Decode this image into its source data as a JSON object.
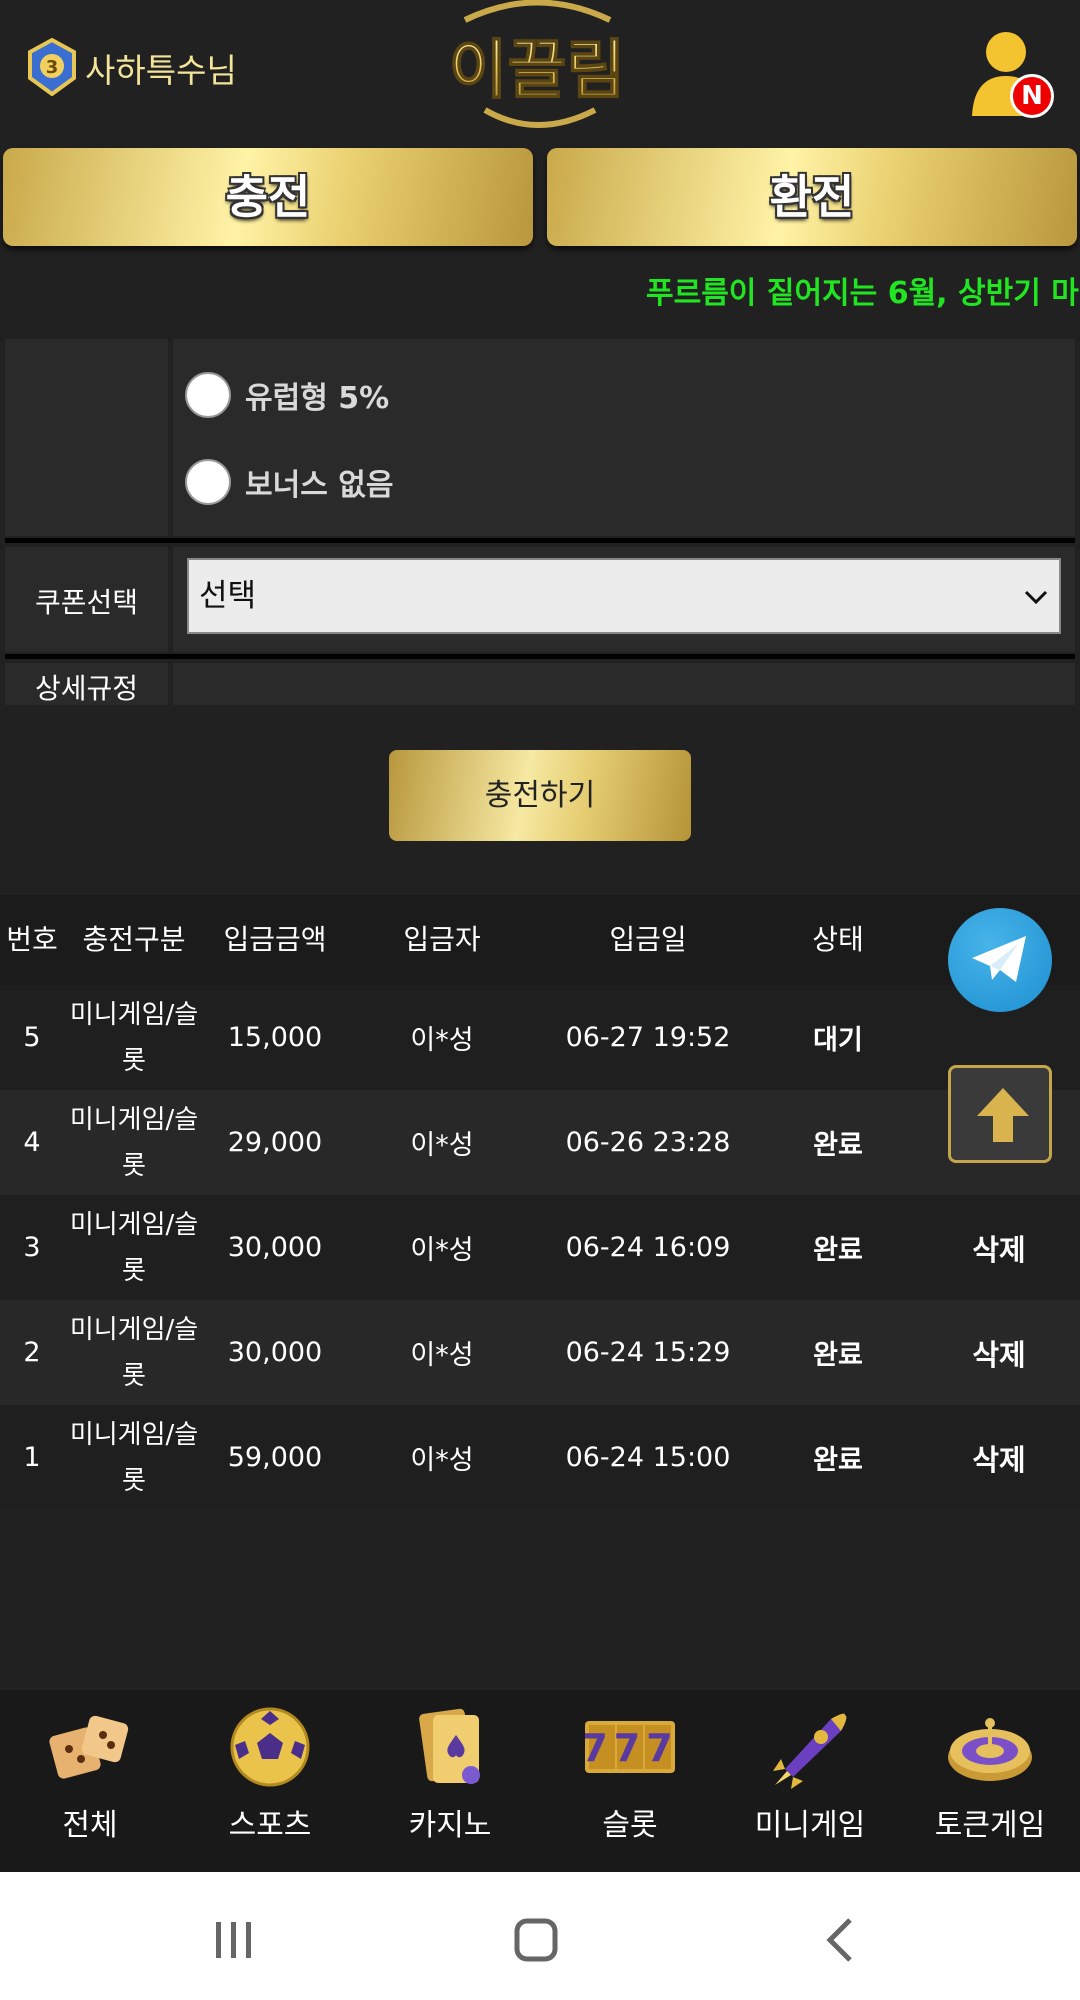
{
  "header": {
    "username": "사하특수님",
    "logo_text": "이끌림",
    "notification_badge": "N"
  },
  "actions": {
    "charge_label": "충전",
    "exchange_label": "환전"
  },
  "marquee": {
    "text": "푸르름이 짙어지는 6월, 상반기 마",
    "color": "#22e522"
  },
  "form": {
    "bonus_options": [
      "유럽형 5%",
      "보너스 없음"
    ],
    "coupon_label": "쿠폰선택",
    "coupon_value": "선택",
    "rules_label": "상세규정",
    "submit_label": "충전하기"
  },
  "table": {
    "headers": [
      "번호",
      "충전구분",
      "입금금액",
      "입금자",
      "입금일",
      "상태"
    ],
    "rows": [
      {
        "no": "5",
        "type_line1": "미니게임/슬",
        "type_line2": "롯",
        "amount": "15,000",
        "depositor": "이*성",
        "date": "06-27 19:52",
        "status": "대기",
        "action": ""
      },
      {
        "no": "4",
        "type_line1": "미니게임/슬",
        "type_line2": "롯",
        "amount": "29,000",
        "depositor": "이*성",
        "date": "06-26 23:28",
        "status": "완료",
        "action": ""
      },
      {
        "no": "3",
        "type_line1": "미니게임/슬",
        "type_line2": "롯",
        "amount": "30,000",
        "depositor": "이*성",
        "date": "06-24 16:09",
        "status": "완료",
        "action": "삭제"
      },
      {
        "no": "2",
        "type_line1": "미니게임/슬",
        "type_line2": "롯",
        "amount": "30,000",
        "depositor": "이*성",
        "date": "06-24 15:29",
        "status": "완료",
        "action": "삭제"
      },
      {
        "no": "1",
        "type_line1": "미니게임/슬",
        "type_line2": "롯",
        "amount": "59,000",
        "depositor": "이*성",
        "date": "06-24 15:00",
        "status": "완료",
        "action": "삭제"
      }
    ]
  },
  "bottom_nav": {
    "items": [
      {
        "label": "전체",
        "icon": "dice-icon"
      },
      {
        "label": "스포츠",
        "icon": "soccer-ball-icon"
      },
      {
        "label": "카지노",
        "icon": "cards-icon"
      },
      {
        "label": "슬롯",
        "icon": "slot-777-icon"
      },
      {
        "label": "미니게임",
        "icon": "rocket-icon"
      },
      {
        "label": "토큰게임",
        "icon": "roulette-icon"
      }
    ]
  },
  "slot_icon_text": "777",
  "colors": {
    "gold": "#e9cf6e",
    "background": "#212121",
    "telegram": "#2aa3e0"
  }
}
